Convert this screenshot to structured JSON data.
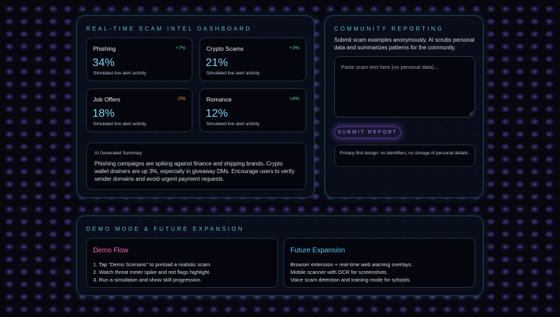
{
  "dashboard": {
    "title": "REAL-TIME SCAM INTEL DASHBOARD",
    "stats": [
      {
        "name": "Phishing",
        "delta": "+7%",
        "value": "34%",
        "caption": "Simulated live alert activity",
        "trend": "up"
      },
      {
        "name": "Crypto Scams",
        "delta": "+3%",
        "value": "21%",
        "caption": "Simulated live alert activity",
        "trend": "up"
      },
      {
        "name": "Job Offers",
        "delta": "-2%",
        "value": "18%",
        "caption": "Simulated live alert activity",
        "trend": "down"
      },
      {
        "name": "Romance",
        "delta": "+4%",
        "value": "12%",
        "caption": "Simulated live alert activity",
        "trend": "up"
      }
    ],
    "summary": {
      "heading": "AI Generated Summary",
      "text": "Phishing campaigns are spiking against finance and shipping brands. Crypto wallet drainers are up 3%, especially in giveaway DMs. Encourage users to verify sender domains and avoid urgent payment requests."
    }
  },
  "community": {
    "title": "COMMUNITY REPORTING",
    "description": "Submit scam examples anonymously. AI scrubs personal data and summarizes patterns for the community.",
    "textarea_placeholder": "Paste scam text here (no personal data)...",
    "textarea_value": "",
    "submit_label": "SUBMIT REPORT",
    "privacy_note": "Privacy-first design: no identifiers, no storage of personal details."
  },
  "demo": {
    "title": "DEMO MODE & FUTURE EXPANSION",
    "flow": {
      "heading": "Demo Flow",
      "lines": [
        "1. Tap “Demo Scenario” to preload a realistic scam.",
        "2. Watch threat meter spike and red flags highlight.",
        "3. Run a simulation and show skill progression."
      ]
    },
    "future": {
      "heading": "Future Expansion",
      "lines": [
        "Browser extension + real-time web warning overlays.",
        "Mobile scanner with OCR for screenshots.",
        "Voice scam detection and training mode for schools."
      ]
    }
  },
  "colors": {
    "accent_cyan": "#5bbfd6",
    "stat_value": "#7fd2f2",
    "delta_positive": "#45d58a",
    "delta_negative": "#e6a03a",
    "button_purple": "#a98bff",
    "demo_flow_pink": "#f06baf",
    "future_blue": "#5bc6ec"
  }
}
